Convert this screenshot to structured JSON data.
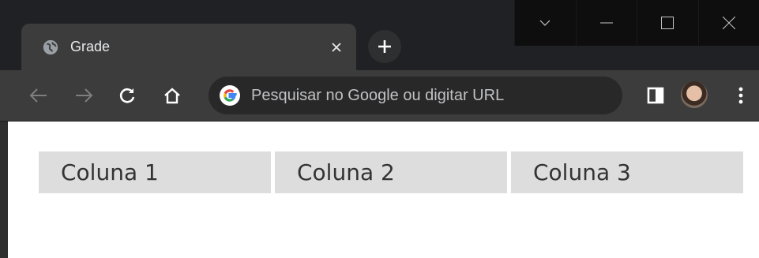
{
  "tab": {
    "title": "Grade"
  },
  "omnibox": {
    "placeholder": "Pesquisar no Google ou digitar URL"
  },
  "grid": {
    "columns": [
      "Coluna 1",
      "Coluna 2",
      "Coluna 3"
    ]
  },
  "icons": {
    "tab_favicon": "globe-icon",
    "tab_close": "close-icon",
    "new_tab": "plus-icon",
    "back": "arrow-left-icon",
    "forward": "arrow-right-icon",
    "reload": "reload-icon",
    "home": "home-icon",
    "google": "google-icon",
    "side_panel": "side-panel-icon",
    "menu": "kebab-menu-icon",
    "caption_dropdown": "chevron-down-icon",
    "minimize": "minimize-icon",
    "maximize": "maximize-icon",
    "close_window": "close-icon"
  },
  "colors": {
    "chrome_dark": "#202124",
    "tab_active": "#3c3c3c",
    "omnibox_bg": "#282828",
    "grid_cell_bg": "#dddddd",
    "grid_text": "#333333"
  }
}
